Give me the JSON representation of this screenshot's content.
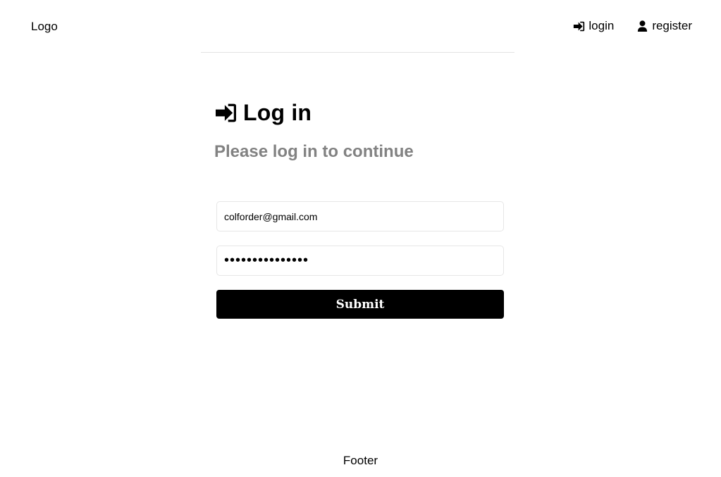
{
  "header": {
    "logo": "Logo",
    "nav": [
      {
        "label": "login",
        "icon": "sign-in-icon"
      },
      {
        "label": "register",
        "icon": "user-icon"
      }
    ]
  },
  "main": {
    "title": "Log in",
    "title_icon": "sign-in-icon",
    "subtitle": "Please log in to continue",
    "form": {
      "email_value": "colforder@gmail.com",
      "password_value": "•••••••••••••••",
      "submit_label": "Submit"
    }
  },
  "footer": {
    "text": "Footer"
  },
  "colors": {
    "background": "#ffffff",
    "text": "#000000",
    "subtitle": "#828282",
    "button_bg": "#000000",
    "button_text": "#ffffff",
    "field_border": "#e6e6e6",
    "divider": "#e3e3e3"
  }
}
